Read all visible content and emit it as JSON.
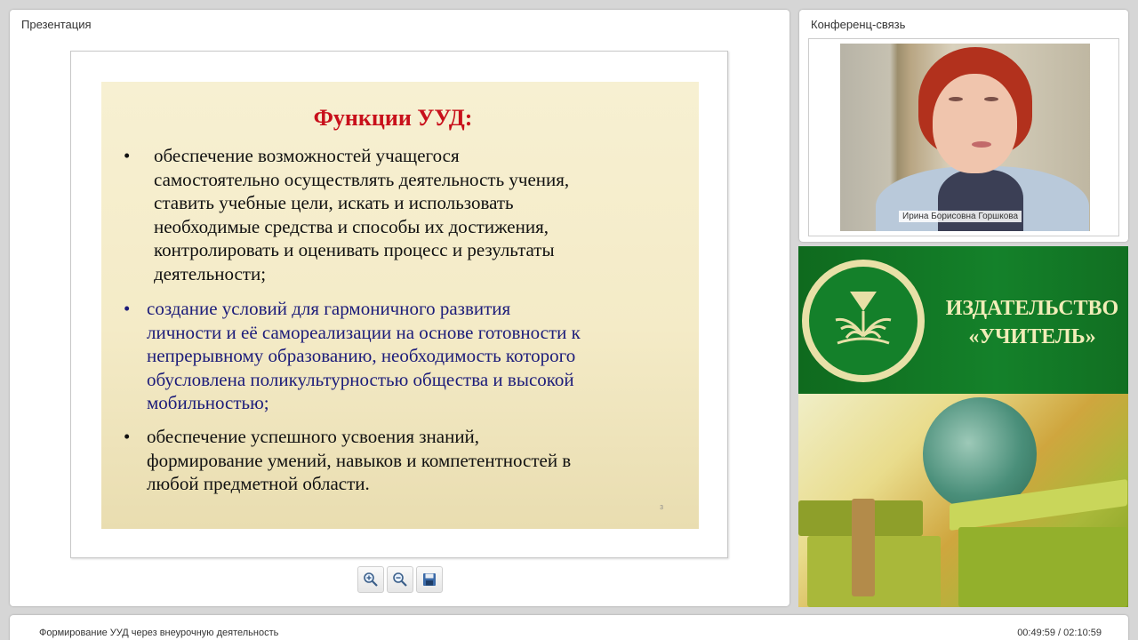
{
  "presentation": {
    "panel_title": "Презентация",
    "slide": {
      "title": "Функции УУД:",
      "bullets": [
        {
          "marker": "•",
          "text": "обеспечение возможностей учащегося\nсамостоятельно осуществлять деятельность учения,\nставить учебные цели, искать и использовать\nнеобходимые средства и способы их достижения,\nконтролировать и оценивать  процесс и результаты\nдеятельности;"
        },
        {
          "marker": "•",
          "text": "создание условий для гармоничного развития\nличности и её самореализации на основе готовности к\nнепрерывному образованию, необходимость которого\nобусловлена поликультурностью общества и высокой\nмобильностью;"
        },
        {
          "marker": "•",
          "text": "обеспечение успешного усвоения знаний,\nформирование умений, навыков и компетентностей в\nлюбой предметной области."
        }
      ],
      "slide_number": "3"
    },
    "toolbar": {
      "zoom_in_icon": "zoom-in-icon",
      "zoom_out_icon": "zoom-out-icon",
      "save_icon": "save-icon"
    }
  },
  "conference": {
    "panel_title": "Конференц-связь",
    "speaker_name": "Ирина Борисовна Горшкова"
  },
  "banner": {
    "line1": "ИЗДАТЕЛЬСТВО",
    "line2": "«УЧИТЕЛЬ»"
  },
  "footer": {
    "title": "Формирование УУД через внеурочную деятельность",
    "time": "00:49:59 / 02:10:59"
  },
  "colors": {
    "slide_title": "#c8101b",
    "bullet_blue": "#1c1c7a",
    "banner_green": "#14812a",
    "banner_text": "#f1edb8"
  }
}
